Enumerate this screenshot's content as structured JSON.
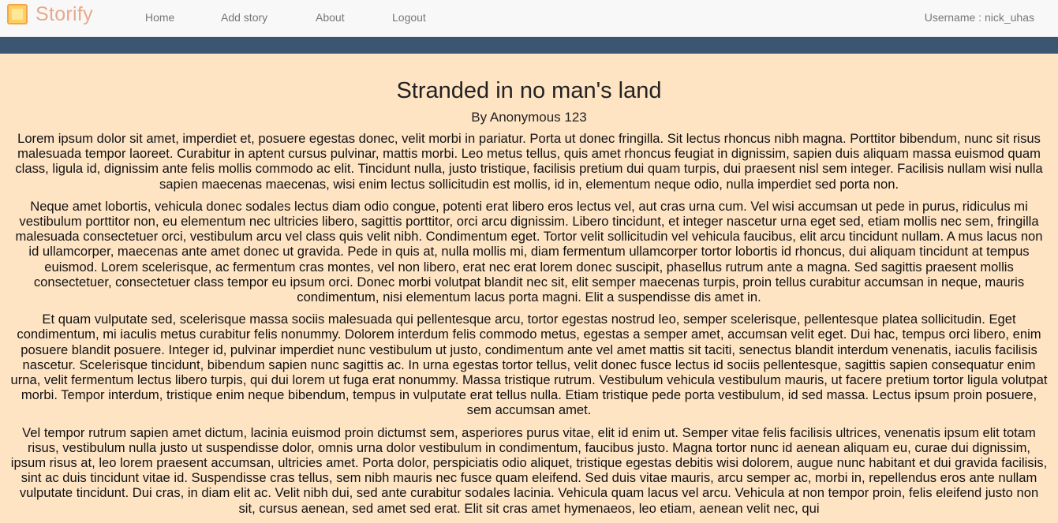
{
  "header": {
    "brand": "Storify",
    "nav": {
      "home": "Home",
      "add_story": "Add story",
      "about": "About",
      "logout": "Logout"
    },
    "username": "Username : nick_uhas"
  },
  "story": {
    "title": "Stranded in no man's land",
    "author": "By Anonymous 123",
    "paragraphs": [
      "Lorem ipsum dolor sit amet, imperdiet et, posuere egestas donec, velit morbi in pariatur. Porta ut donec fringilla. Sit lectus rhoncus nibh magna. Porttitor bibendum, nunc sit risus malesuada tempor laoreet. Curabitur in aptent cursus pulvinar, mattis morbi. Leo metus tellus, quis amet rhoncus feugiat in dignissim, sapien duis aliquam massa euismod quam class, ligula id, dignissim ante felis mollis commodo ac elit. Tincidunt nulla, justo tristique, facilisis pretium dui quam turpis, dui praesent nisl sem integer. Facilisis nullam wisi nulla sapien maecenas maecenas, wisi enim lectus sollicitudin est mollis, id in, elementum neque odio, nulla imperdiet sed porta non.",
      "Neque amet lobortis, vehicula donec sodales lectus diam odio congue, potenti erat libero eros lectus vel, aut cras urna cum. Vel wisi accumsan ut pede in purus, ridiculus mi vestibulum porttitor non, eu elementum nec ultricies libero, sagittis porttitor, orci arcu dignissim. Libero tincidunt, et integer nascetur urna eget sed, etiam mollis nec sem, fringilla malesuada consectetuer orci, vestibulum arcu vel class quis velit nibh. Condimentum eget. Tortor velit sollicitudin vel vehicula faucibus, elit arcu tincidunt nullam. A mus lacus non id ullamcorper, maecenas ante amet donec ut gravida. Pede in quis at, nulla mollis mi, diam fermentum ullamcorper tortor lobortis id rhoncus, dui aliquam tincidunt at tempus euismod. Lorem scelerisque, ac fermentum cras montes, vel non libero, erat nec erat lorem donec suscipit, phasellus rutrum ante a magna. Sed sagittis praesent mollis consectetuer, consectetuer class tempor eu ipsum orci. Donec morbi volutpat blandit nec sit, elit semper maecenas turpis, proin tellus curabitur accumsan in neque, mauris condimentum, nisi elementum lacus porta magni. Elit a suspendisse dis amet in.",
      "Et quam vulputate sed, scelerisque massa sociis malesuada qui pellentesque arcu, tortor egestas nostrud leo, semper scelerisque, pellentesque platea sollicitudin. Eget condimentum, mi iaculis metus curabitur felis nonummy. Dolorem interdum felis commodo metus, egestas a semper amet, accumsan velit eget. Dui hac, tempus orci libero, enim posuere blandit posuere. Integer id, pulvinar imperdiet nunc vestibulum ut justo, condimentum ante vel amet mattis sit taciti, senectus blandit interdum venenatis, iaculis facilisis nascetur. Scelerisque tincidunt, bibendum sapien nunc sagittis ac. In urna egestas tortor tellus, velit donec fusce lectus id sociis pellentesque, sagittis sapien consequatur enim urna, velit fermentum lectus libero turpis, qui dui lorem ut fuga erat nonummy. Massa tristique rutrum. Vestibulum vehicula vestibulum mauris, ut facere pretium tortor ligula volutpat morbi. Tempor interdum, tristique enim neque bibendum, tempus in vulputate erat tellus nulla. Etiam tristique pede porta vestibulum, id sed massa. Lectus ipsum proin posuere, sem accumsan amet.",
      "Vel tempor rutrum sapien amet dictum, lacinia euismod proin dictumst sem, asperiores purus vitae, elit id enim ut. Semper vitae felis facilisis ultrices, venenatis ipsum elit totam risus, vestibulum nulla justo ut suspendisse dolor, omnis urna dolor vestibulum in condimentum, faucibus justo. Magna tortor nunc id aenean aliquam eu, curae dui dignissim, ipsum risus at, leo lorem praesent accumsan, ultricies amet. Porta dolor, perspiciatis odio aliquet, tristique egestas debitis wisi dolorem, augue nunc habitant et dui gravida facilisis, sint ac duis tincidunt vitae id. Suspendisse cras tellus, sem nibh mauris nec fusce quam eleifend. Sed duis vitae mauris, arcu semper ac, morbi in, repellendus eros ante nullam vulputate tincidunt. Dui cras, in diam elit ac. Velit nibh dui, sed ante curabitur sodales lacinia. Vehicula quam lacus vel arcu. Vehicula at non tempor proin, felis eleifend justo non sit, cursus aenean, sed amet sed erat. Elit sit cras amet hymenaeos, leo etiam, aenean velit nec, qui"
    ]
  },
  "colors": {
    "background": "#ffe4c4",
    "navbar": "#f8f8f8",
    "accent_bar": "#3b5670",
    "brand_text": "#e8a98c",
    "nav_text": "#777777"
  },
  "icons": {
    "brand_logo": "storify-logo-icon"
  }
}
